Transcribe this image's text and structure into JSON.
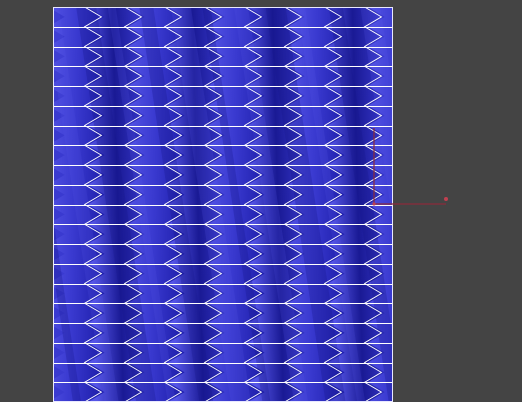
{
  "viewport": {
    "background_color": "#444444"
  },
  "mesh": {
    "surface_colors": {
      "base": "#3a3ad0",
      "light": "#5a5aea",
      "dark": "#1c1ca8",
      "darker": "#14148a"
    },
    "edge_color": "#ffffff",
    "border_color": "#e8e8ff",
    "horizontal_rows": 20,
    "vertical_columns": 8,
    "pattern": "chevron-fold"
  },
  "gizmo": {
    "axis_color": "#8a2a3a",
    "handle_color": "#c04050",
    "icon": "transform-axis-icon"
  }
}
